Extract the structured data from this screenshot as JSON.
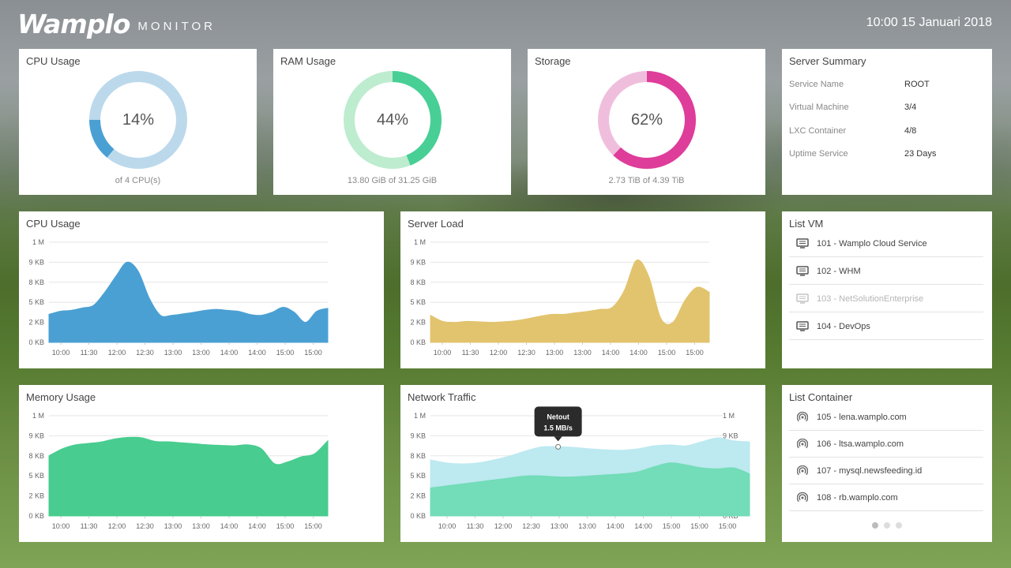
{
  "header": {
    "logo": "Wamplo",
    "logo_sub": "MONITOR",
    "datetime": "10:00 15 Januari 2018"
  },
  "colors": {
    "cpu": "#4ba0d3",
    "cpu_track": "#bcd9ec",
    "ram": "#48cf96",
    "ram_track": "#bdeccf",
    "storage": "#de3d9a",
    "storage_track": "#f0bedd",
    "load": "#e2c46e",
    "memory": "#48cc8f",
    "net_out": "#bde9f0",
    "net_in": "#73dcb9"
  },
  "gauges": [
    {
      "title": "CPU Usage",
      "value_label": "14%",
      "fraction": 0.14,
      "sub": "of 4 CPU(s)",
      "color_key": "cpu"
    },
    {
      "title": "RAM Usage",
      "value_label": "44%",
      "fraction": 0.44,
      "sub": "13.80 GiB of 31.25 GiB",
      "color_key": "ram"
    },
    {
      "title": "Storage",
      "value_label": "62%",
      "fraction": 0.62,
      "sub": "2.73 TiB of 4.39 TiB",
      "color_key": "storage"
    }
  ],
  "summary": {
    "title": "Server Summary",
    "rows": [
      {
        "key": "Service Name",
        "value": "ROOT"
      },
      {
        "key": "Virtual Machine",
        "value": "3/4"
      },
      {
        "key": "LXC Container",
        "value": "4/8"
      },
      {
        "key": "Uptime Service",
        "value": "23 Days"
      }
    ]
  },
  "list_vm": {
    "title": "List VM",
    "items": [
      {
        "label": "101 - Wamplo Cloud Service",
        "icon": "monitor-icon",
        "disabled": false
      },
      {
        "label": "102 - WHM",
        "icon": "monitor-icon",
        "disabled": false
      },
      {
        "label": "103 - NetSolutionEnterprise",
        "icon": "monitor-icon",
        "disabled": true
      },
      {
        "label": "104 - DevOps",
        "icon": "monitor-icon",
        "disabled": false
      }
    ]
  },
  "list_container": {
    "title": "List Container",
    "items": [
      {
        "label": "105 - lena.wamplo.com",
        "icon": "signal-icon"
      },
      {
        "label": "106 - ltsa.wamplo.com",
        "icon": "signal-icon"
      },
      {
        "label": "107 - mysql.newsfeeding.id",
        "icon": "signal-icon"
      },
      {
        "label": "108 - rb.wamplo.com",
        "icon": "signal-icon"
      }
    ],
    "pages": 3,
    "active_page": 1
  },
  "tooltip": {
    "title": "Netout",
    "value": "1.5 MB/s"
  },
  "chart_data": [
    {
      "type": "area",
      "title": "CPU Usage",
      "y_ticks": [
        "0 KB",
        "2 KB",
        "5 KB",
        "8 KB",
        "9 KB",
        "1 M"
      ],
      "x_ticks": [
        "10:00",
        "11:30",
        "12:00",
        "12:30",
        "13:00",
        "13:00",
        "14:00",
        "14:00",
        "15:00",
        "15:00"
      ],
      "series": [
        {
          "color_key": "cpu",
          "values": [
            1.4,
            1.55,
            1.6,
            1.72,
            1.85,
            2.5,
            3.3,
            4.0,
            3.55,
            2.2,
            1.35,
            1.35,
            1.42,
            1.5,
            1.6,
            1.65,
            1.6,
            1.55,
            1.4,
            1.35,
            1.5,
            1.75,
            1.5,
            1.0,
            1.55,
            1.7
          ]
        }
      ]
    },
    {
      "type": "area",
      "title": "Server Load",
      "y_ticks": [
        "0 KB",
        "2 KB",
        "5 KB",
        "8 KB",
        "9 KB",
        "1 M"
      ],
      "x_ticks": [
        "10:00",
        "11:30",
        "12:00",
        "12:30",
        "13:00",
        "13:00",
        "14:00",
        "14:00",
        "15:00",
        "15:00"
      ],
      "series": [
        {
          "color_key": "load",
          "values": [
            1.35,
            1.05,
            1.0,
            1.05,
            1.03,
            1.0,
            1.03,
            1.08,
            1.18,
            1.3,
            1.4,
            1.4,
            1.48,
            1.55,
            1.65,
            1.75,
            2.6,
            4.1,
            3.3,
            1.2,
            1.0,
            2.1,
            2.75,
            2.5
          ]
        }
      ]
    },
    {
      "type": "area",
      "title": "Memory Usage",
      "y_ticks": [
        "0 KB",
        "2 KB",
        "5 KB",
        "8 KB",
        "9 KB",
        "1 M"
      ],
      "x_ticks": [
        "10:00",
        "11:30",
        "12:00",
        "12:30",
        "13:00",
        "13:00",
        "14:00",
        "14:00",
        "15:00",
        "15:00"
      ],
      "series": [
        {
          "color_key": "memory",
          "values": [
            3.0,
            3.35,
            3.55,
            3.62,
            3.7,
            3.85,
            3.92,
            3.9,
            3.72,
            3.7,
            3.65,
            3.6,
            3.55,
            3.52,
            3.5,
            3.55,
            3.35,
            2.6,
            2.7,
            2.95,
            3.1,
            3.75
          ]
        }
      ]
    },
    {
      "type": "area",
      "title": "Network Traffic",
      "y_ticks": [
        "0 KB",
        "2 KB",
        "5 KB",
        "8 KB",
        "9 KB",
        "1 M"
      ],
      "x_ticks": [
        "10:00",
        "11:30",
        "12:00",
        "12:30",
        "13:00",
        "13:00",
        "14:00",
        "14:00",
        "15:00",
        "15:00",
        "15:00"
      ],
      "series": [
        {
          "name": "Netout",
          "color_key": "net_out",
          "values": [
            2.8,
            2.65,
            2.6,
            2.65,
            2.8,
            3.0,
            3.25,
            3.45,
            3.45,
            3.42,
            3.35,
            3.3,
            3.28,
            3.35,
            3.5,
            3.55,
            3.5,
            3.7,
            3.9,
            3.75,
            3.7
          ]
        },
        {
          "color_key": "net_in",
          "values": [
            1.4,
            1.5,
            1.6,
            1.7,
            1.8,
            1.9,
            2.0,
            2.0,
            1.95,
            1.95,
            2.0,
            2.05,
            2.1,
            2.2,
            2.45,
            2.65,
            2.55,
            2.4,
            2.35,
            2.4,
            2.1
          ]
        }
      ],
      "highlight_index": 8
    }
  ]
}
